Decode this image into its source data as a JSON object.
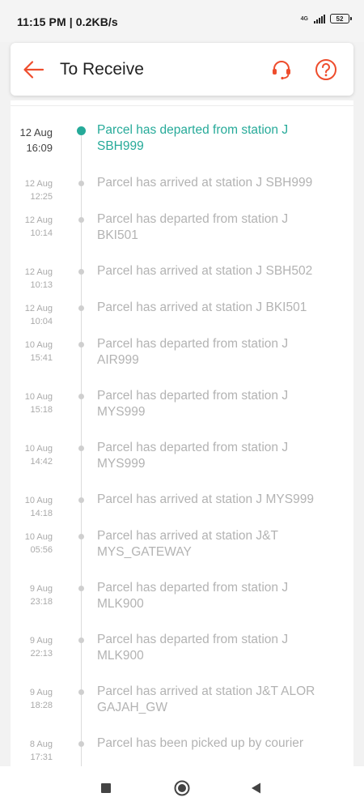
{
  "status_bar": {
    "time": "11:15 PM | 0.2KB/s",
    "network": "4G",
    "battery": "52"
  },
  "header": {
    "title": "To Receive",
    "accent_color": "#ee4d2d"
  },
  "timeline": {
    "active_color": "#26aa99",
    "events": [
      {
        "day": "12 Aug",
        "time": "16:09",
        "text": "Parcel has departed from station J SBH999"
      },
      {
        "day": "12 Aug",
        "time": "12:25",
        "text": "Parcel has arrived at station J SBH999"
      },
      {
        "day": "12 Aug",
        "time": "10:14",
        "text": "Parcel has departed from station J BKI501"
      },
      {
        "day": "12 Aug",
        "time": "10:13",
        "text": "Parcel has arrived at station J SBH502"
      },
      {
        "day": "12 Aug",
        "time": "10:04",
        "text": "Parcel has arrived at station J BKI501"
      },
      {
        "day": "10 Aug",
        "time": "15:41",
        "text": "Parcel has departed from station J AIR999"
      },
      {
        "day": "10 Aug",
        "time": "15:18",
        "text": "Parcel has departed from station J MYS999"
      },
      {
        "day": "10 Aug",
        "time": "14:42",
        "text": "Parcel has departed from station J MYS999"
      },
      {
        "day": "10 Aug",
        "time": "14:18",
        "text": "Parcel has arrived at station J MYS999"
      },
      {
        "day": "10 Aug",
        "time": "05:56",
        "text": "Parcel has arrived at station J&T MYS_GATEWAY"
      },
      {
        "day": "9 Aug",
        "time": "23:18",
        "text": "Parcel has departed from station J MLK900"
      },
      {
        "day": "9 Aug",
        "time": "22:13",
        "text": "Parcel has departed from station J MLK900"
      },
      {
        "day": "9 Aug",
        "time": "18:28",
        "text": "Parcel has arrived at station J&T ALOR GAJAH_GW"
      },
      {
        "day": "8 Aug",
        "time": "17:31",
        "text": "Parcel has been picked up by courier"
      }
    ]
  },
  "nav_bar": {
    "icons": [
      "square-recents-icon",
      "circle-home-icon",
      "triangle-back-icon"
    ]
  }
}
